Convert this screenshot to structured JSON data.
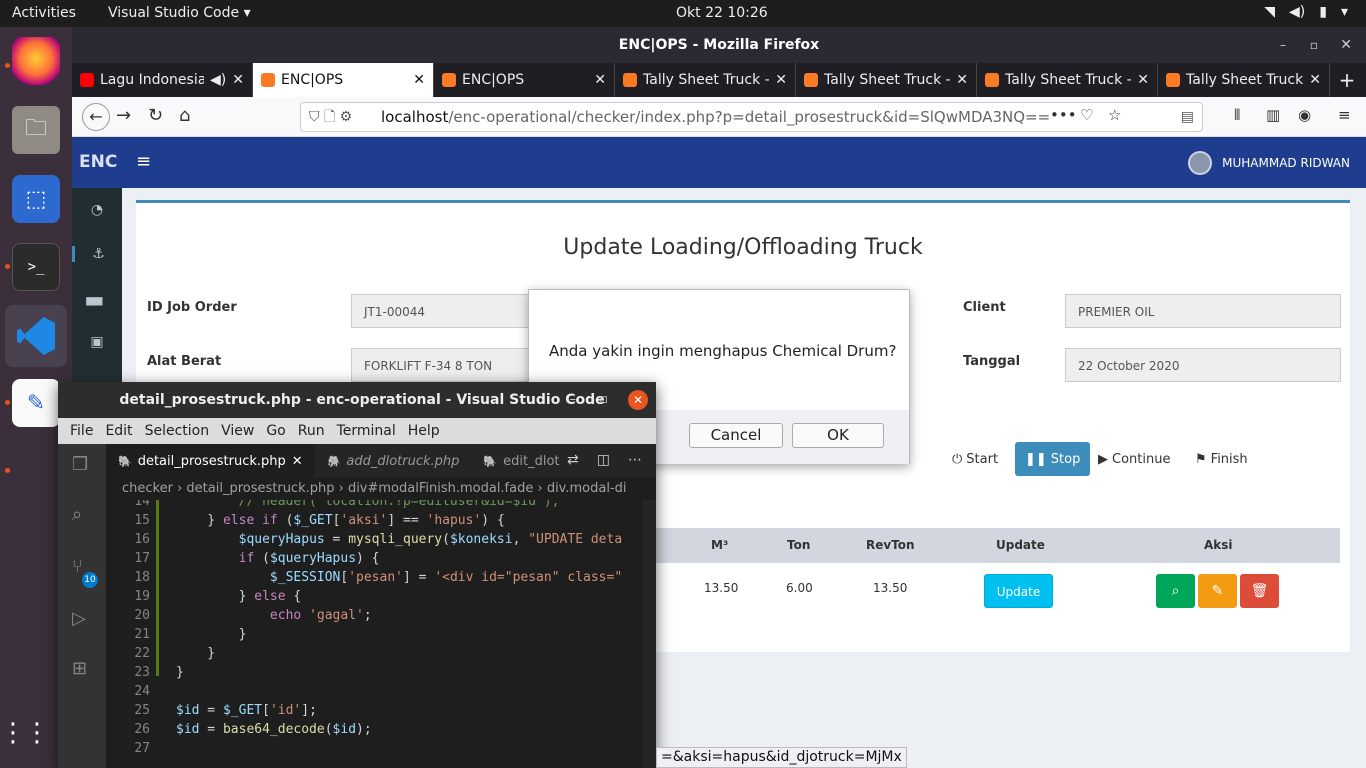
{
  "topbar": {
    "activities": "Activities",
    "app_name": "Visual Studio Code ▾",
    "clock": "Okt 22  10:26"
  },
  "firefox": {
    "title": "ENC|OPS - Mozilla Firefox",
    "tabs": [
      {
        "label": "Lagu Indonesia",
        "favicon_color": "#ff0000"
      },
      {
        "label": "ENC|OPS",
        "favicon_color": "#fb7a24"
      },
      {
        "label": "ENC|OPS",
        "favicon_color": "#fb7a24"
      },
      {
        "label": "Tally Sheet Truck -",
        "favicon_color": "#fb7a24"
      },
      {
        "label": "Tally Sheet Truck -",
        "favicon_color": "#fb7a24"
      },
      {
        "label": "Tally Sheet Truck -",
        "favicon_color": "#fb7a24"
      },
      {
        "label": "Tally Sheet Truck -",
        "favicon_color": "#fb7a24"
      }
    ],
    "url_host": "localhost",
    "url_path": "/enc-operational/checker/index.php?p=detail_prosestruck&id=SlQwMDA3NQ=="
  },
  "webapp": {
    "brand": "ENC",
    "user_name": "MUHAMMAD RIDWAN",
    "page_title": "Update Loading/Offloading Truck",
    "fields": {
      "job_order_label": "ID Job Order",
      "job_order_value": "JT1-00044",
      "alat_berat_label": "Alat Berat",
      "alat_berat_value": "FORKLIFT F-34  8 TON",
      "client_label": "Client",
      "client_value": "PREMIER OIL",
      "tanggal_label": "Tanggal",
      "tanggal_value": "22 October 2020"
    },
    "process_buttons": {
      "start": "Start",
      "stop": "Stop",
      "continue": "Continue",
      "finish": "Finish"
    },
    "table": {
      "headers": [
        "M³",
        "Ton",
        "RevTon",
        "Update",
        "Aksi"
      ],
      "row": {
        "m3": "13.50",
        "ton": "6.00",
        "revton": "13.50"
      },
      "update_label": "Update"
    }
  },
  "dialog": {
    "message": "Anda yakin ingin menghapus Chemical Drum?",
    "cancel": "Cancel",
    "ok": "OK"
  },
  "vscode": {
    "title": "detail_prosestruck.php - enc-operational - Visual Studio Code",
    "menu": [
      "File",
      "Edit",
      "Selection",
      "View",
      "Go",
      "Run",
      "Terminal",
      "Help"
    ],
    "tabs": [
      "detail_prosestruck.php",
      "add_dlotruck.php",
      "edit_dlot"
    ],
    "breadcrumb": "checker  ›  detail_prosestruck.php  ›  div#modalFinish.modal.fade  ›  div.modal-di",
    "scm_badge": "10",
    "line_numbers": [
      "14",
      "15",
      "16",
      "17",
      "18",
      "19",
      "20",
      "21",
      "22",
      "23",
      "24",
      "25",
      "26",
      "27"
    ]
  },
  "status_link": "=&aksi=hapus&id_djotruck=MjMx"
}
